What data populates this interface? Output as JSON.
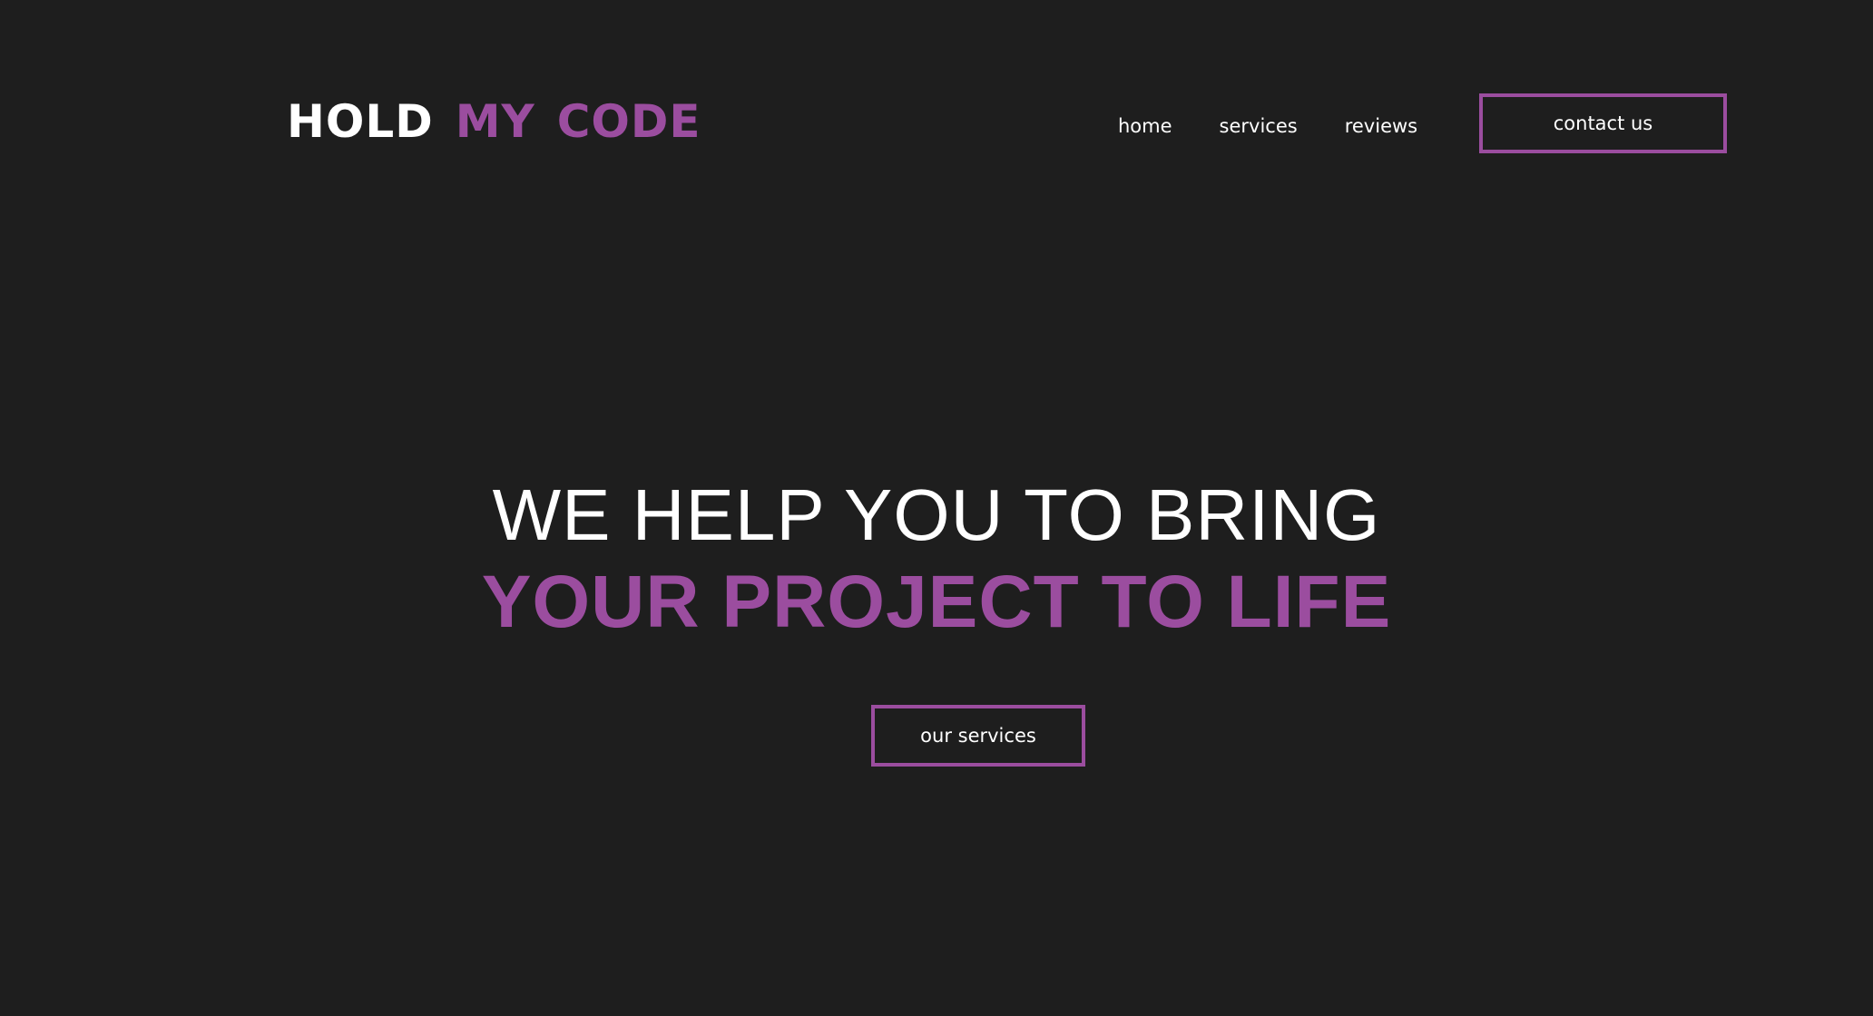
{
  "header": {
    "logo": {
      "word1": "HOLD",
      "word2": "MY",
      "word3": "CODE"
    },
    "nav": [
      {
        "label": "home"
      },
      {
        "label": "services"
      },
      {
        "label": "reviews"
      }
    ],
    "contact_label": "contact us"
  },
  "hero": {
    "line1": "WE HELP YOU TO BRING",
    "line2": "YOUR PROJECT TO LIFE",
    "cta_label": "our services"
  },
  "colors": {
    "background": "#1e1e1e",
    "accent": "#9b4d9f",
    "text": "#ffffff"
  }
}
